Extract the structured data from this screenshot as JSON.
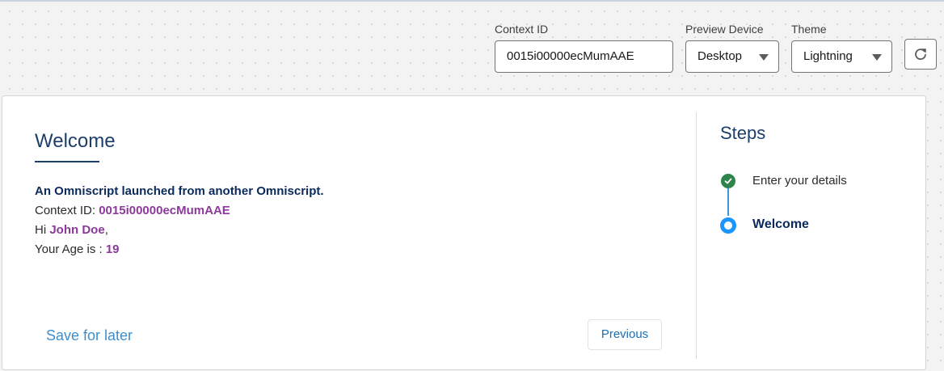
{
  "toolbar": {
    "context_id_label": "Context ID",
    "context_id_value": "0015i00000ecMumAAE",
    "preview_device_label": "Preview Device",
    "preview_device_value": "Desktop",
    "theme_label": "Theme",
    "theme_value": "Lightning",
    "refresh_icon": "refresh-icon"
  },
  "main": {
    "title": "Welcome",
    "line1": "An Omniscript launched from another Omniscript.",
    "context_prefix": "Context ID: ",
    "context_value": "0015i00000ecMumAAE",
    "hi_prefix": "Hi ",
    "name": "John Doe",
    "hi_suffix": ",",
    "age_prefix": "Your Age is : ",
    "age_value": "19",
    "save_for_later": "Save for later",
    "previous": "Previous"
  },
  "steps": {
    "title": "Steps",
    "items": [
      {
        "label": "Enter your details",
        "status": "complete"
      },
      {
        "label": "Welcome",
        "status": "current"
      }
    ]
  },
  "colors": {
    "accent_blue": "#1b96ff",
    "complete_green": "#2e844a",
    "merge_purple": "#8a3a9a",
    "heading_navy": "#1b3e6a"
  }
}
